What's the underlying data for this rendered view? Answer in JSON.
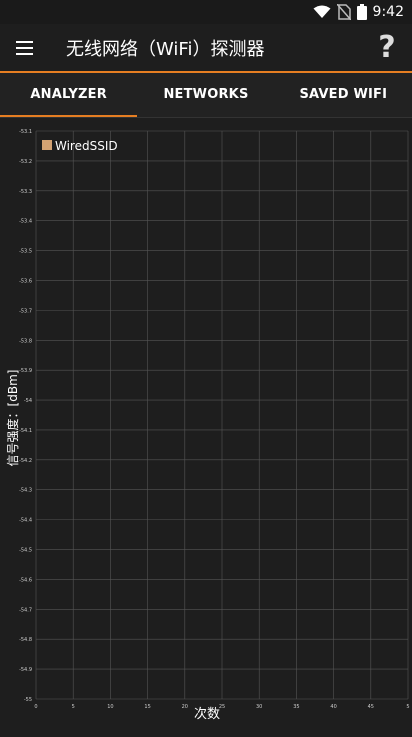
{
  "status_bar": {
    "time": "9:42",
    "icons": [
      "wifi-icon",
      "no-sim-icon",
      "battery-icon"
    ]
  },
  "app_bar": {
    "title": "无线网络（WiFi）探测器",
    "menu_icon": "hamburger-menu-icon",
    "help_icon": "help-icon",
    "help_label": "?"
  },
  "tabs": [
    {
      "label": "ANALYZER",
      "active": true
    },
    {
      "label": "NETWORKS",
      "active": false
    },
    {
      "label": "SAVED WIFI",
      "active": false
    }
  ],
  "colors": {
    "accent": "#e67e22",
    "background": "#1e1e1e",
    "grid": "#555555",
    "series": "#d4a373"
  },
  "chart_data": {
    "type": "line",
    "xlabel": "次数",
    "ylabel": "信号强度：[dBm]",
    "xlim": [
      0,
      50
    ],
    "ylim": [
      -55,
      -53.1
    ],
    "x_ticks": [
      "0",
      "5",
      "10",
      "15",
      "20",
      "25",
      "30",
      "35",
      "40",
      "45",
      "5"
    ],
    "y_ticks": [
      "-53.1",
      "-53.2",
      "-53.3",
      "-53.4",
      "-53.5",
      "-53.6",
      "-53.7",
      "-53.8",
      "-53.9",
      "-54",
      "-54.1",
      "-54.2",
      "-54.3",
      "-54.4",
      "-54.5",
      "-54.6",
      "-54.7",
      "-54.8",
      "-54.9",
      "-55"
    ],
    "grid": true,
    "legend_position": "top-left",
    "series": [
      {
        "name": "WiredSSID",
        "color": "#d4a373",
        "values": []
      }
    ]
  }
}
